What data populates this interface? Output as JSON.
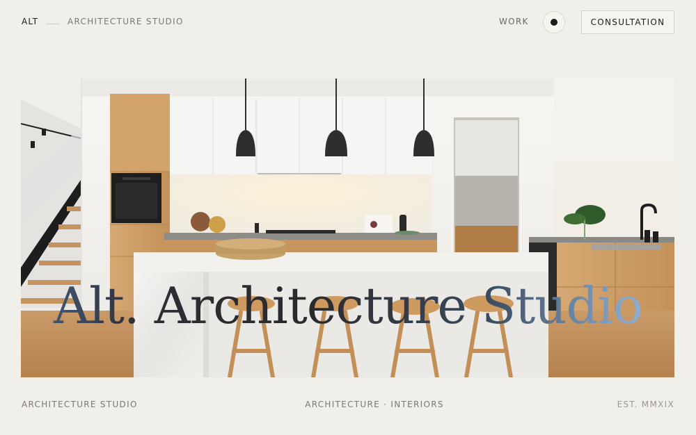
{
  "header": {
    "brand": "ALT",
    "tagline": "ARCHITECTURE STUDIO",
    "nav_work": "WORK",
    "cta": "CONSULTATION"
  },
  "hero": {
    "title": "Alt. Architecture Studio"
  },
  "footer": {
    "left": "ARCHITECTURE STUDIO",
    "center": "ARCHITECTURE · INTERIORS",
    "right": "EST. MMXIX"
  },
  "colors": {
    "background": "#f1efea",
    "text": "#1c1c1c",
    "muted": "#7c776f",
    "accent_blue": "#86a9cf"
  },
  "icons": {
    "theme_toggle": "theme-toggle-dot-icon"
  }
}
